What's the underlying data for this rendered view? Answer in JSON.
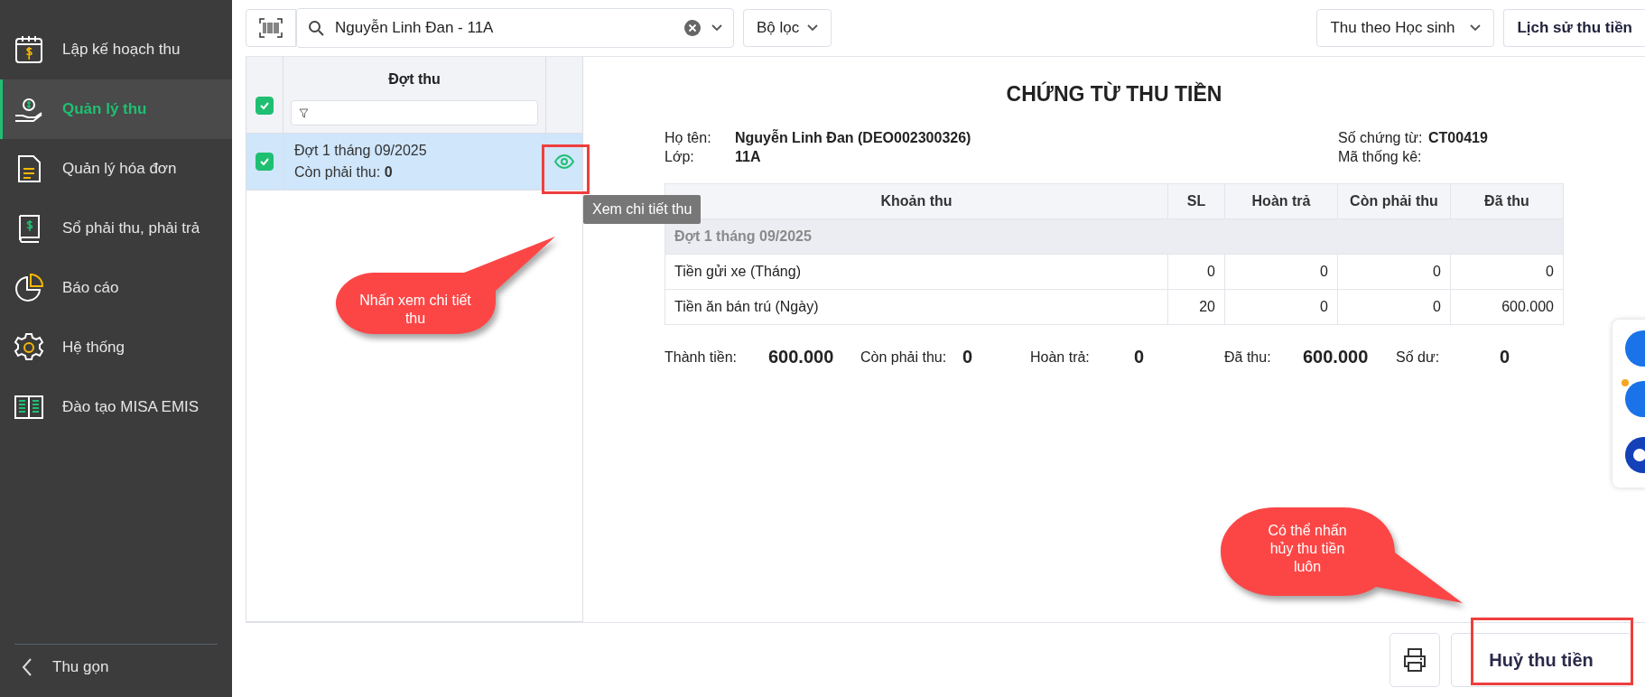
{
  "sidebar": {
    "items": [
      {
        "label": "Lập kế hoạch thu",
        "selected": false
      },
      {
        "label": "Quản lý thu",
        "selected": true
      },
      {
        "label": "Quản lý hóa đơn",
        "selected": false
      },
      {
        "label": "Sổ phải thu, phải trả",
        "selected": false
      },
      {
        "label": "Báo cáo",
        "selected": false
      },
      {
        "label": "Hệ thống",
        "selected": false
      },
      {
        "label": "Đào tạo MISA EMIS",
        "selected": false
      }
    ],
    "collapse": "Thu gọn"
  },
  "toolbar": {
    "search": {
      "value": "Nguyễn Linh Đan - 11A"
    },
    "filter": "Bộ lọc",
    "mode": "Thu theo Học sinh",
    "history_button": "Lịch sử thu tiền"
  },
  "periods": {
    "header": "Đợt thu",
    "all_checked": true,
    "rows": [
      {
        "title": "Đợt 1 tháng 09/2025",
        "due_label": "Còn phải thu:",
        "due_value": "0",
        "checked": true,
        "selected": true
      }
    ]
  },
  "tooltip": "Xem chi tiết thu",
  "voucher": {
    "title": "CHỨNG TỪ THU TIỀN",
    "left_info": [
      {
        "label": "Họ tên:",
        "value": "Nguyễn Linh Đan (DEO002300326)"
      },
      {
        "label": "Lớp:",
        "value": "11A"
      }
    ],
    "right_info": [
      {
        "label": "Số chứng từ:",
        "value": "CT00419"
      },
      {
        "label": "Mã thống kê:"
      }
    ],
    "columns": [
      "Khoản thu",
      "SL",
      "Hoàn trả",
      "Còn phải thu",
      "Đã thu"
    ],
    "group": "Đợt 1 tháng 09/2025",
    "rows": [
      [
        "Tiền gửi xe (Tháng)",
        "0",
        "0",
        "0",
        "0"
      ],
      [
        "Tiền ăn bán trú (Ngày)",
        "20",
        "0",
        "0",
        "600.000"
      ]
    ],
    "summary": [
      {
        "label": "Thành tiền:",
        "value": "600.000"
      },
      {
        "label": "Còn phải thu:",
        "value": "0"
      },
      {
        "label": "Hoàn trả:",
        "value": "0"
      },
      {
        "label": "Đã thu:",
        "value": "600.000"
      },
      {
        "label": "Số dư:",
        "value": "0"
      }
    ]
  },
  "footer": {
    "cancel_button": "Huỷ thu tiền"
  },
  "callouts": [
    {
      "text": "Nhấn xem chi tiết thu"
    },
    {
      "text": "Có thể nhấn hủy thu tiền luôn"
    }
  ]
}
